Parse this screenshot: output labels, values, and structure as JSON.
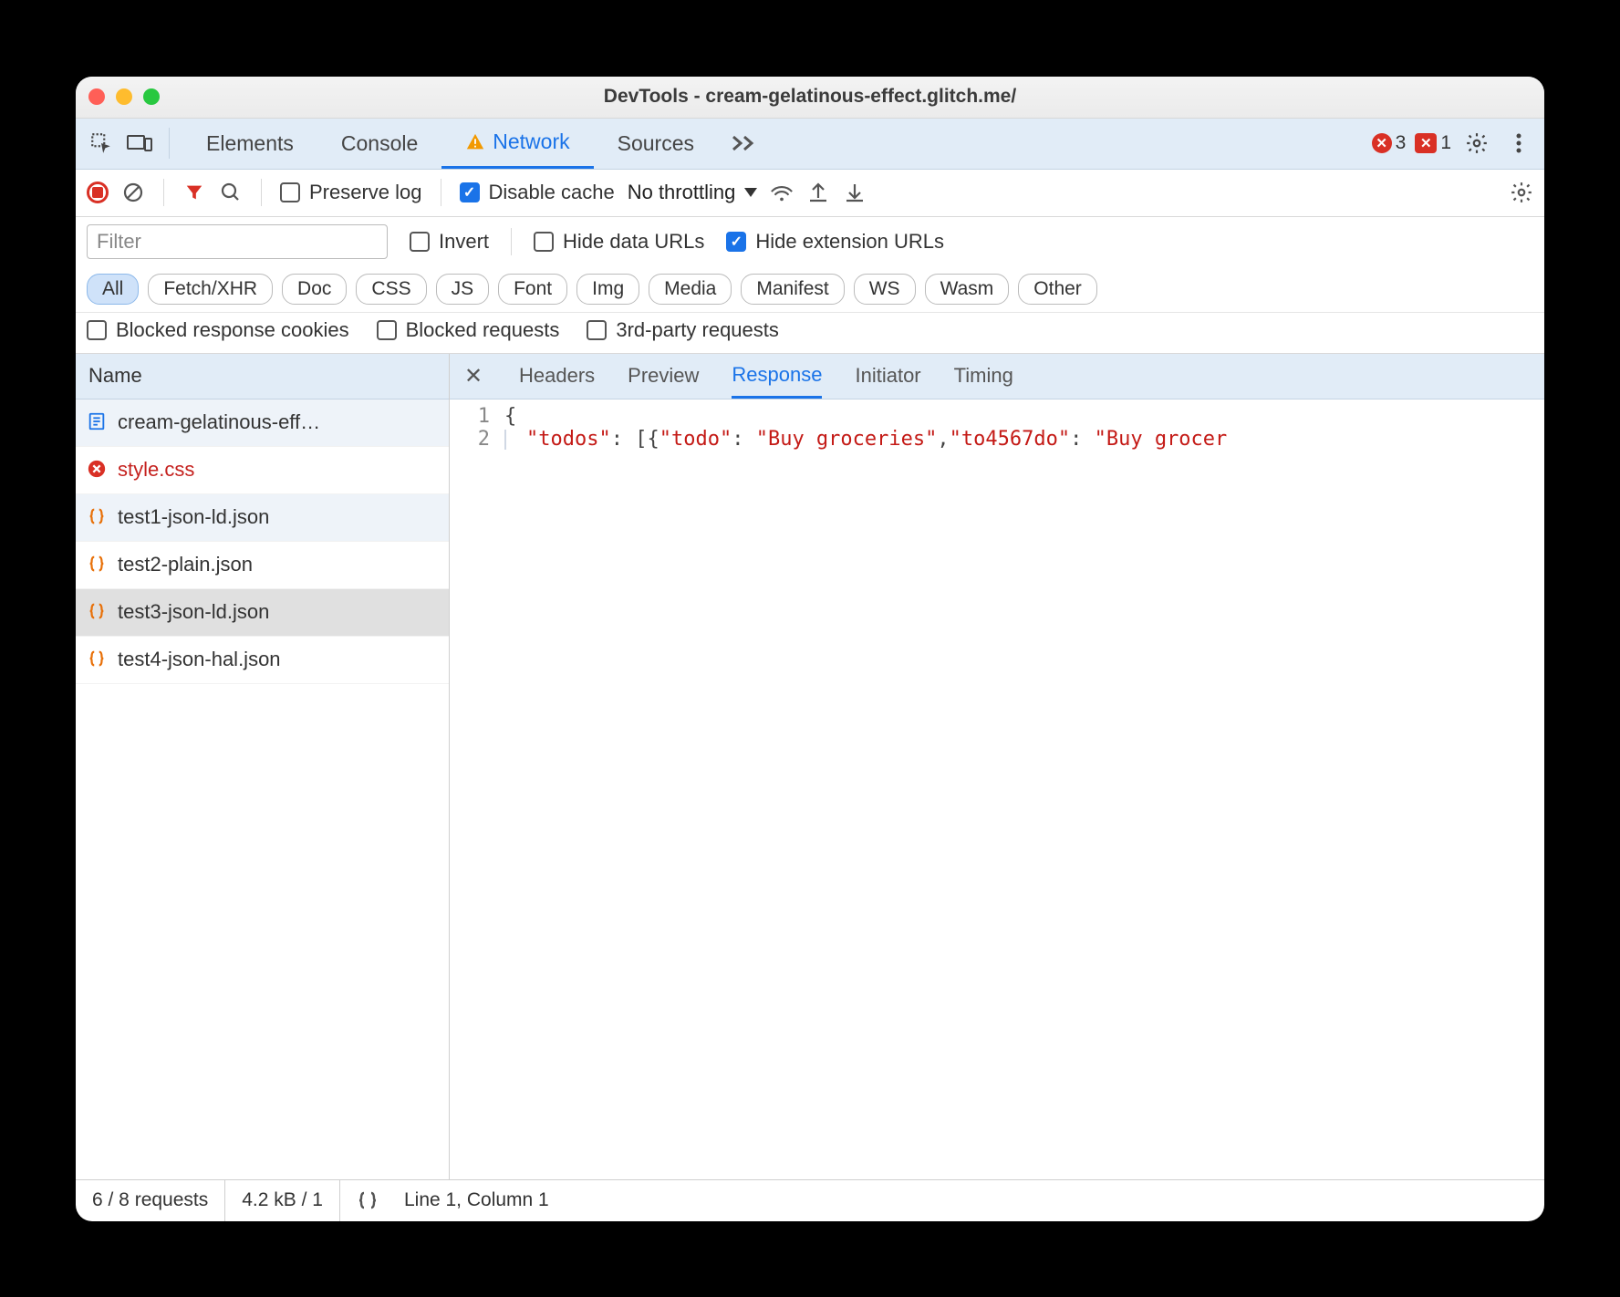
{
  "window": {
    "title": "DevTools - cream-gelatinous-effect.glitch.me/"
  },
  "title_bold": "DevTools",
  "title_rest": " - cream-gelatinous-effect.glitch.me/",
  "tabs": {
    "items": [
      "Elements",
      "Console",
      "Network",
      "Sources"
    ],
    "active": "Network",
    "errors": {
      "count": "3"
    },
    "issues": {
      "count": "1"
    }
  },
  "toolbar": {
    "preserve_log": "Preserve log",
    "disable_cache": "Disable cache",
    "throttling": "No throttling"
  },
  "filter": {
    "placeholder": "Filter",
    "invert": "Invert",
    "hide_data_urls": "Hide data URLs",
    "hide_ext_urls": "Hide extension URLs",
    "types": [
      "All",
      "Fetch/XHR",
      "Doc",
      "CSS",
      "JS",
      "Font",
      "Img",
      "Media",
      "Manifest",
      "WS",
      "Wasm",
      "Other"
    ],
    "blocked_cookies": "Blocked response cookies",
    "blocked_requests": "Blocked requests",
    "third_party": "3rd-party requests"
  },
  "requests": {
    "header": "Name",
    "items": [
      {
        "name": "cream-gelatinous-eff…",
        "icon": "doc",
        "state": "alt"
      },
      {
        "name": "style.css",
        "icon": "error",
        "state": "error"
      },
      {
        "name": "test1-json-ld.json",
        "icon": "json",
        "state": "alt"
      },
      {
        "name": "test2-plain.json",
        "icon": "json",
        "state": ""
      },
      {
        "name": "test3-json-ld.json",
        "icon": "json",
        "state": "selected"
      },
      {
        "name": "test4-json-hal.json",
        "icon": "json",
        "state": ""
      }
    ]
  },
  "detail": {
    "tabs": [
      "Headers",
      "Preview",
      "Response",
      "Initiator",
      "Timing"
    ],
    "active": "Response",
    "response_json": {
      "lines": [
        "1",
        "2"
      ],
      "line2_tokens": {
        "k1": "\"todos\"",
        "p1": ": [",
        "p2": "{",
        "k2": "\"todo\"",
        "p3": ": ",
        "s1": "\"Buy groceries\"",
        "p4": ",",
        "k3": "\"to4567do\"",
        "p5": ": ",
        "s2": "\"Buy grocer"
      }
    }
  },
  "status": {
    "requests": "6 / 8 requests",
    "transfer": "4.2 kB / 1",
    "cursor": "Line 1, Column 1"
  }
}
